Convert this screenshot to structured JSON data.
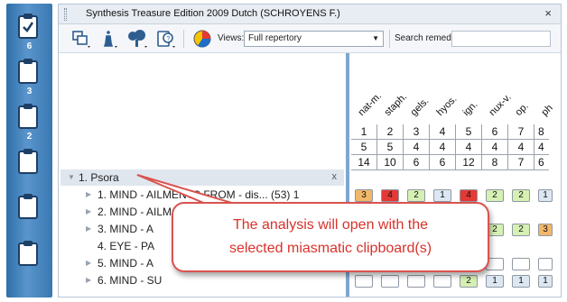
{
  "window": {
    "title": "Synthesis Treasure Edition 2009 Dutch (SCHROYENS F.)",
    "close": "×"
  },
  "toolbar": {
    "views_label": "Views:",
    "views_value": "Full repertory",
    "search_label": "Search remedy:"
  },
  "rail": {
    "counts": [
      "6",
      "3",
      "2"
    ]
  },
  "clipboard": {
    "name": "1. Psora",
    "close": "x"
  },
  "rubrics": [
    {
      "text": "1. MIND - AILMENTS FROM - dis...  (53) 1",
      "expandable": true
    },
    {
      "text": "2. MIND - AILM",
      "expandable": true
    },
    {
      "text": "3. MIND - A",
      "expandable": true
    },
    {
      "text": "4. EYE - PA",
      "expandable": false
    },
    {
      "text": "5. MIND - A",
      "expandable": true
    },
    {
      "text": "6. MIND - SU",
      "expandable": true
    }
  ],
  "remedies": [
    "nat-m.",
    "staph.",
    "gels.",
    "hyos.",
    "ign.",
    "nux-v.",
    "op.",
    "ph"
  ],
  "grid": {
    "rank": [
      "1",
      "2",
      "3",
      "4",
      "5",
      "6",
      "7",
      "8"
    ],
    "rubric_count": [
      "5",
      "5",
      "4",
      "4",
      "4",
      "4",
      "4",
      "4"
    ],
    "score": [
      "14",
      "10",
      "6",
      "6",
      "12",
      "8",
      "7",
      "6"
    ]
  },
  "grades_row1": [
    "3",
    "4",
    "2",
    "1",
    "4",
    "2",
    "2",
    "1"
  ],
  "grades_row3": [
    "",
    "",
    "",
    "",
    "",
    "2",
    "2",
    "3"
  ],
  "grades_row5": [
    "",
    "",
    "",
    "",
    "",
    "",
    "",
    ""
  ],
  "grades_row6": [
    "",
    "",
    "",
    "",
    "2",
    "1",
    "1",
    "1"
  ],
  "callout": {
    "line1": "The analysis will open with the",
    "line2": "selected miasmatic clipboard(s)"
  },
  "colors": {
    "accent_red": "#e53935",
    "grade_green": "#d6f0b4",
    "grade_blue": "#dce7f2",
    "grade_orange": "#f2b86a",
    "callout_text": "#d9322b"
  }
}
